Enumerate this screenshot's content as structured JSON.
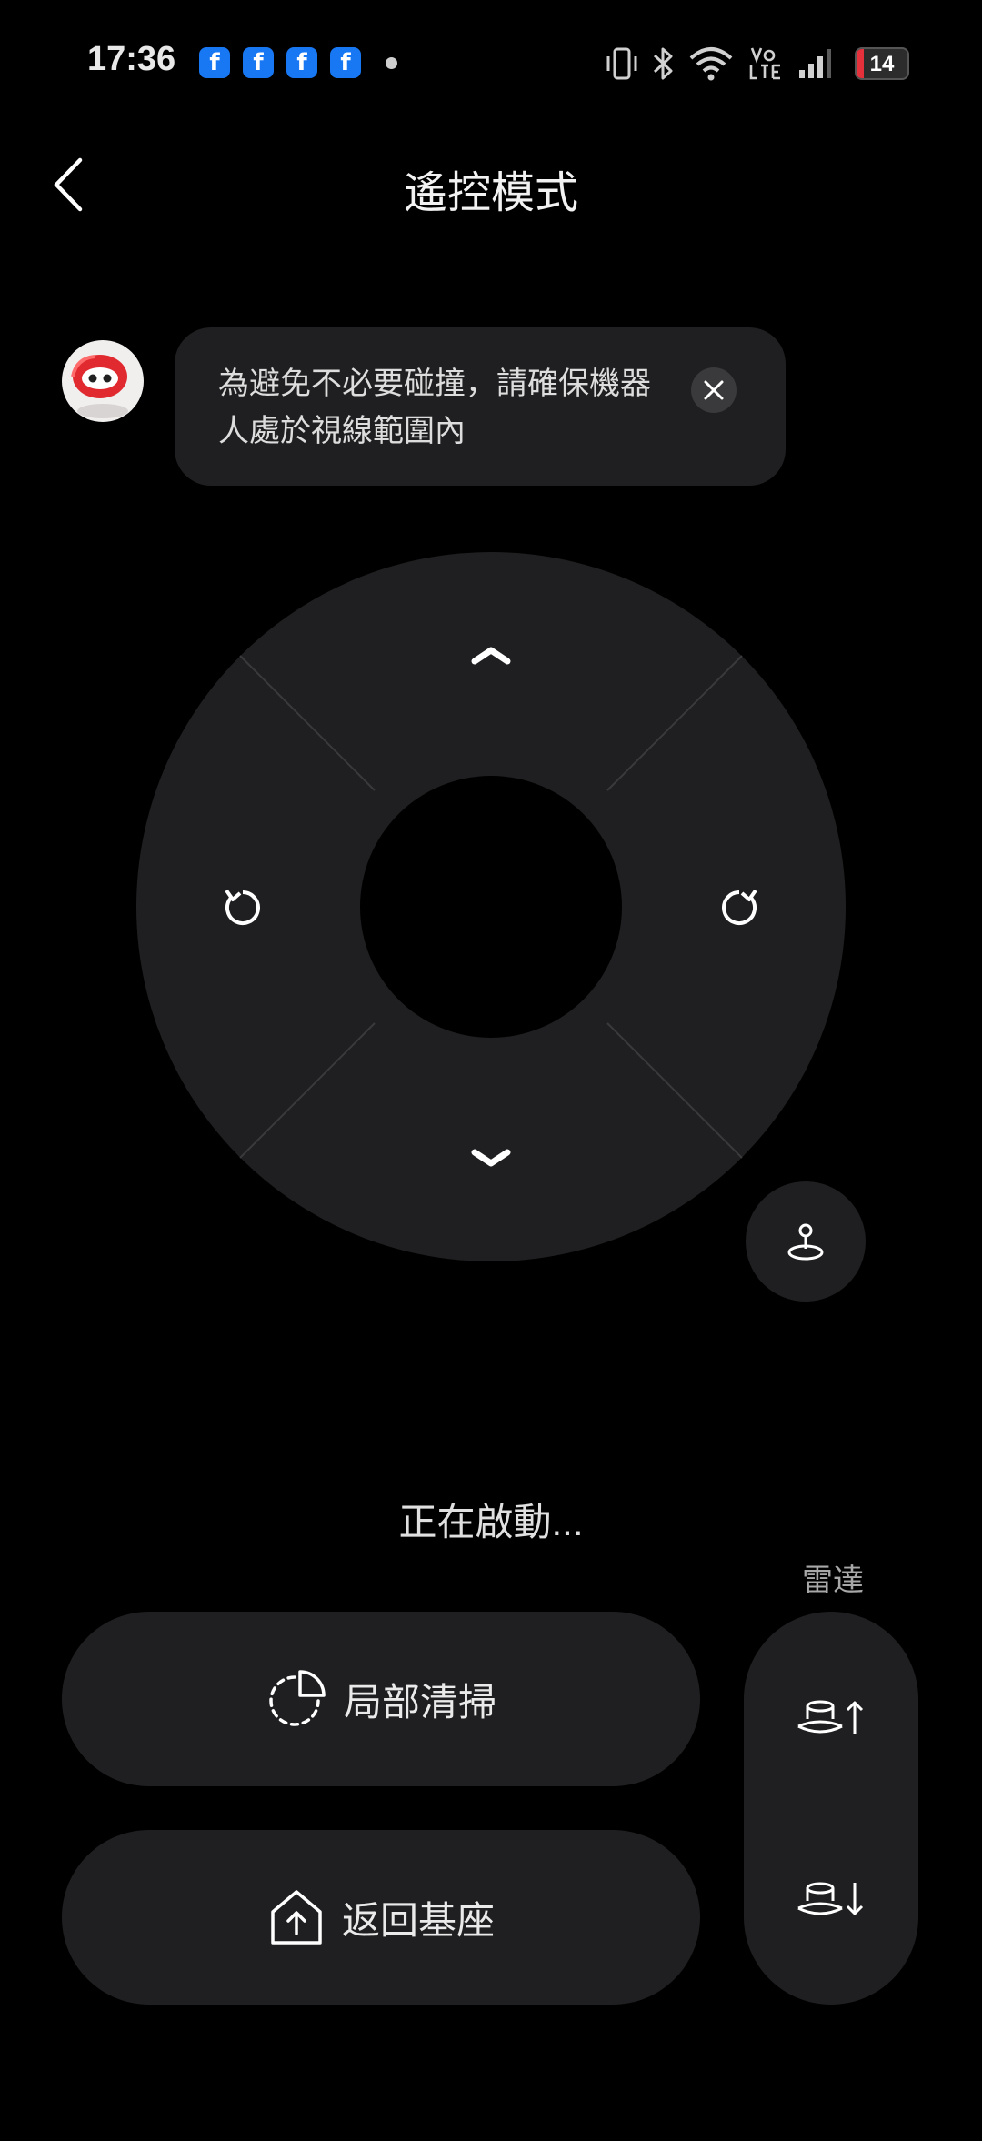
{
  "status_bar": {
    "time": "17:36",
    "notification_app": "f",
    "battery": "14"
  },
  "header": {
    "title": "遙控模式"
  },
  "tip": {
    "text": "為避免不必要碰撞，請確保機器人處於視線範圍內"
  },
  "status": {
    "text": "正在啟動..."
  },
  "radar": {
    "label": "雷達"
  },
  "actions": {
    "spot_clean": "局部清掃",
    "return_dock": "返回基座"
  },
  "icons": {
    "back": "chevron-left-icon",
    "close": "close-icon",
    "up": "chevron-up-icon",
    "down": "chevron-down-icon",
    "rotate_left": "rotate-ccw-icon",
    "rotate_right": "rotate-cw-icon",
    "joystick": "joystick-icon",
    "radar_up": "radar-raise-icon",
    "radar_down": "radar-lower-icon",
    "spot_clean": "dashed-pie-icon",
    "return_dock": "home-arrow-up-icon"
  },
  "colors": {
    "background": "#000000",
    "surface": "#1f1f21",
    "battery_low": "#e5313b",
    "facebook": "#1877f2"
  }
}
